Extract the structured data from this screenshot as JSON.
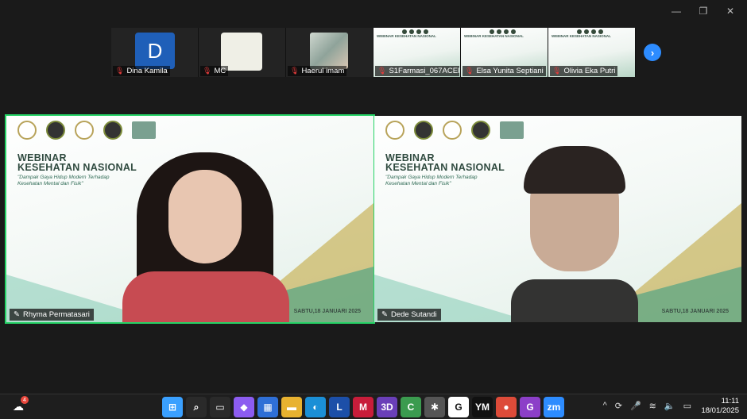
{
  "window": {
    "minimize_icon": "—",
    "restore_icon": "❐",
    "close_icon": "✕"
  },
  "thumbnails": [
    {
      "name": "Dina Kamila",
      "avatar_letter": "D",
      "muted": true
    },
    {
      "name": "MC",
      "muted": true
    },
    {
      "name": "Haerul imam",
      "muted": true
    },
    {
      "name": "S1Farmasi_067ACEP-...",
      "muted": true,
      "slide_title": "WEBINAR KESEHATAN NASIONAL"
    },
    {
      "name": "Elsa Yunita Septiani",
      "muted": true,
      "slide_title": "WEBINAR KESEHATAN NASIONAL"
    },
    {
      "name": "Olivia Eka Putri",
      "muted": true,
      "slide_title": "WEBINAR KESEHATAN NASIONAL"
    }
  ],
  "next_page_icon": "›",
  "tiles": [
    {
      "name": "Rhyma Permatasari",
      "active": true,
      "webinar_line1": "WEBINAR",
      "webinar_line2": "KESEHATAN NASIONAL",
      "quote": "\"Dampak Gaya Hidup Modern Terhadap Kesehatan Mental dan Fisik\"",
      "date": "SABTU,18 JANUARI 2025"
    },
    {
      "name": "Dede Sutandi",
      "active": false,
      "webinar_line1": "WEBINAR",
      "webinar_line2": "KESEHATAN NASIONAL",
      "quote": "\"Dampak Gaya Hidup Modern Terhadap Kesehatan Mental dan Fisik\"",
      "date": "SABTU,18 JANUARI 2025"
    }
  ],
  "taskbar": {
    "weather_badge": "4",
    "apps": [
      {
        "icon": "windows-icon",
        "glyph": "⊞",
        "color": "#3aa0ff"
      },
      {
        "icon": "search-icon",
        "glyph": "⌕",
        "color": "#2a2a2a"
      },
      {
        "icon": "task-view-icon",
        "glyph": "▭",
        "color": "#2a2a2a"
      },
      {
        "icon": "copilot-icon",
        "glyph": "◆",
        "color": "#8c5cf0"
      },
      {
        "icon": "store-icon",
        "glyph": "▦",
        "color": "#2f6fd6"
      },
      {
        "icon": "file-explorer-icon",
        "glyph": "▬",
        "color": "#e8b230"
      },
      {
        "icon": "edge-icon",
        "glyph": "◐",
        "color": "#1b8fd6"
      },
      {
        "icon": "l-app-icon",
        "glyph": "L",
        "color": "#1c4fa8"
      },
      {
        "icon": "mendeley-icon",
        "glyph": "M",
        "color": "#c81d3a"
      },
      {
        "icon": "3d-app-icon",
        "glyph": "3D",
        "color": "#6a3fb8"
      },
      {
        "icon": "capcut-icon",
        "glyph": "C",
        "color": "#3b9b4f"
      },
      {
        "icon": "tools-icon",
        "glyph": "✱",
        "color": "#555"
      },
      {
        "icon": "g-app-icon",
        "glyph": "G",
        "color": "#fff"
      },
      {
        "icon": "ym-app-icon",
        "glyph": "YM",
        "color": "#111"
      },
      {
        "icon": "chrome-icon",
        "glyph": "●",
        "color": "#dd4b39"
      },
      {
        "icon": "g-purple-icon",
        "glyph": "G",
        "color": "#8c3fc8"
      },
      {
        "icon": "zoom-icon",
        "glyph": "zm",
        "color": "#2d8cff"
      }
    ],
    "tray": [
      "^",
      "⟳",
      "🎤",
      "≋",
      "🔈",
      "▭"
    ],
    "time": "11:11",
    "date": "18/01/2025"
  }
}
